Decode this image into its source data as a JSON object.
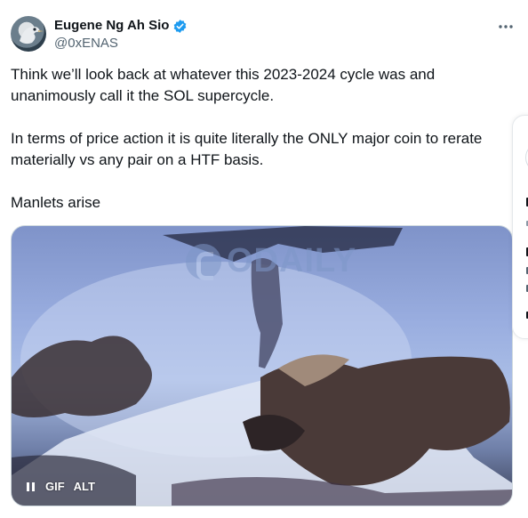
{
  "author": {
    "name": "Eugene Ng Ah Sio",
    "handle": "@0xENAS",
    "verified": true,
    "verified_color": "#1d9bf0"
  },
  "menu": {
    "icon": "more-horizontal-icon"
  },
  "tweet": {
    "paragraphs": [
      "Think we’ll look back at whatever this 2023-2024 cycle was and\nunanimously call it the SOL supercycle.",
      "In terms of price action it is quite literally the ONLY major coin to rerate\nmaterially vs any pair on a HTF basis.",
      "Manlets arise"
    ]
  },
  "media": {
    "type": "gif",
    "watermark": "ODAILY",
    "gif_badge": "GIF",
    "alt_badge": "ALT",
    "pause_icon": "pause-icon"
  },
  "colors": {
    "text": "#0f1419",
    "secondary": "#536471",
    "border": "#cfd9de"
  }
}
